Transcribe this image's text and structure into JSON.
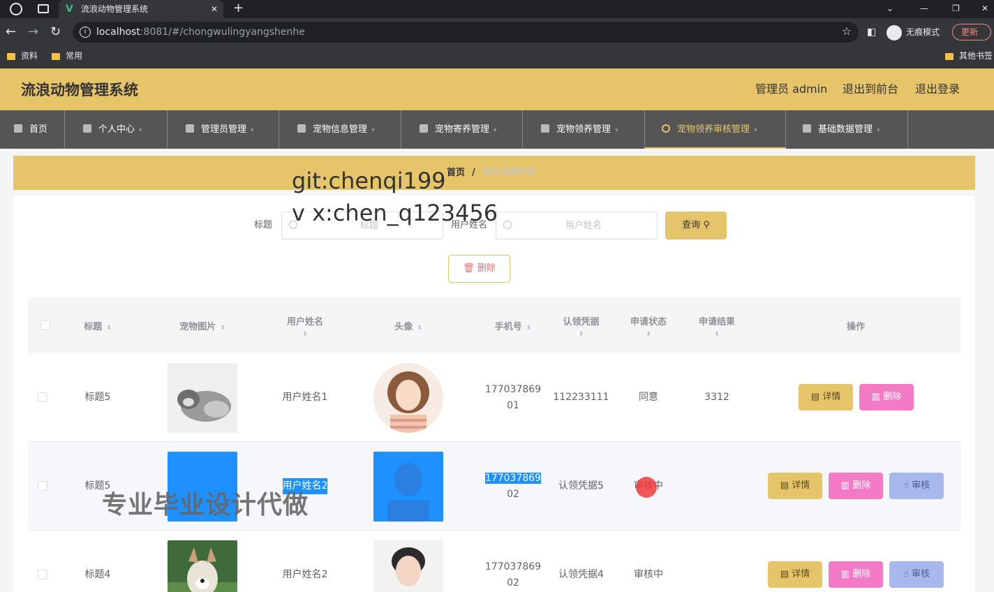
{
  "browser": {
    "tab_title": "流浪动物管理系统",
    "url_host": "localhost",
    "url_path": ":8081/#/chongwulingyangshenhe",
    "incognito_label": "无痕模式",
    "update_label": "更新",
    "bookmarks": [
      "资料",
      "常用"
    ],
    "other_bookmarks": "其他书签"
  },
  "header": {
    "title": "流浪动物管理系统",
    "user": "管理员 admin",
    "to_front": "退出到前台",
    "logout": "退出登录"
  },
  "menu": [
    {
      "label": "首页"
    },
    {
      "label": "个人中心"
    },
    {
      "label": "管理员管理"
    },
    {
      "label": "宠物信息管理"
    },
    {
      "label": "宠物寄养管理"
    },
    {
      "label": "宠物领养管理"
    },
    {
      "label": "宠物领养审核管理"
    },
    {
      "label": "基础数据管理"
    }
  ],
  "breadcrumb": {
    "home": "首页",
    "sep": "/",
    "current": "宠物领养审核"
  },
  "search": {
    "title_label": "标题",
    "title_placeholder": "标题",
    "user_label": "用户姓名",
    "user_placeholder": "用户姓名",
    "query_button": "查询",
    "delete_button": "删除"
  },
  "table": {
    "headers": [
      "标题",
      "宠物图片",
      "用户姓名",
      "头像",
      "手机号",
      "认领凭据",
      "申请状态",
      "申请结果",
      "操作"
    ],
    "rows": [
      {
        "title": "标题5",
        "user": "用户姓名1",
        "phone_a": "177037869",
        "phone_b": "01",
        "proof": "112233111",
        "status": "同意",
        "result": "3312"
      },
      {
        "title": "标题5",
        "user": "用户姓名2",
        "phone_a": "177037869",
        "phone_b": "02",
        "proof": "认领凭据5",
        "status": "审核中",
        "result": ""
      },
      {
        "title": "标题4",
        "user": "用户姓名2",
        "phone_a": "177037869",
        "phone_b": "02",
        "proof": "认领凭据4",
        "status": "审核中",
        "result": ""
      }
    ],
    "btn_detail": "详情",
    "btn_delete": "删除",
    "btn_audit": "审核"
  },
  "watermarks": {
    "line1": "git:chenqi199",
    "line2": "v x:chen_q123456",
    "line3": "专业毕业设计代做"
  }
}
